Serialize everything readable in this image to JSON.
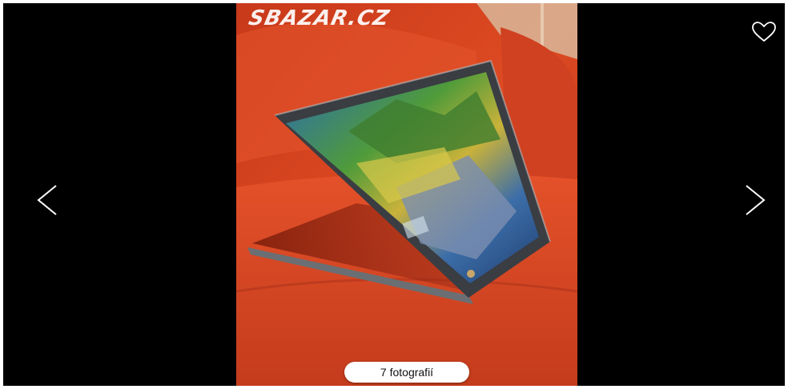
{
  "gallery": {
    "watermark": "SBAZAR.CZ",
    "photo_count_label": "7 fotografií",
    "photo_subject": "Laptop in tent mode on red armchair"
  },
  "icons": {
    "prev": "chevron-left-icon",
    "next": "chevron-right-icon",
    "favorite": "heart-outline-icon"
  },
  "colors": {
    "background": "#000000",
    "chair_red": "#d8401f",
    "button_bg": "#ffffff"
  }
}
